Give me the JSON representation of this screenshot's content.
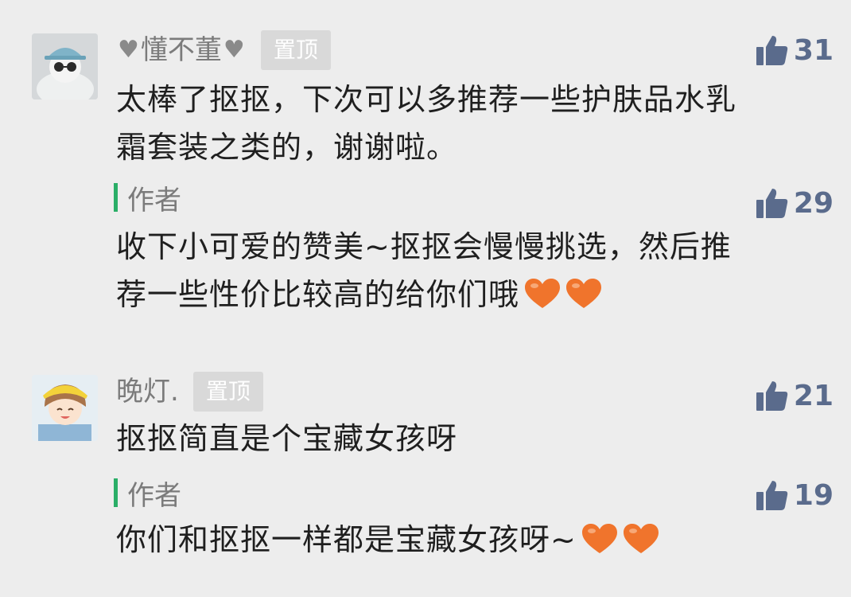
{
  "comments": [
    {
      "nickname": "懂不董",
      "pinned_label": "置顶",
      "likes": "31",
      "text_lines": [
        "太棒了抠抠，下次可以多推荐一些护肤品水乳",
        "霜套装之类的，谢谢啦。"
      ],
      "reply": {
        "author_label": "作者",
        "likes": "29",
        "text_lines": [
          "收下小可爱的赞美~抠抠会慢慢挑选，然后推",
          "荐一些性价比较高的给你们哦"
        ]
      }
    },
    {
      "nickname": "晚灯.",
      "pinned_label": "置顶",
      "likes": "21",
      "text_lines": [
        "抠抠简直是个宝藏女孩呀"
      ],
      "reply": {
        "author_label": "作者",
        "likes": "19",
        "text_lines": [
          "你们和抠抠一样都是宝藏女孩呀~"
        ]
      }
    }
  ],
  "colors": {
    "background": "#ededed",
    "author_bar": "#2aae67",
    "like": "#5a6b8c",
    "heart_emoji": "#f0742c",
    "nickname": "#7b7b7b"
  },
  "icons": [
    "thumbs-up-icon",
    "heart-emoji-icon",
    "heart-symbol-icon",
    "avatar-image"
  ]
}
